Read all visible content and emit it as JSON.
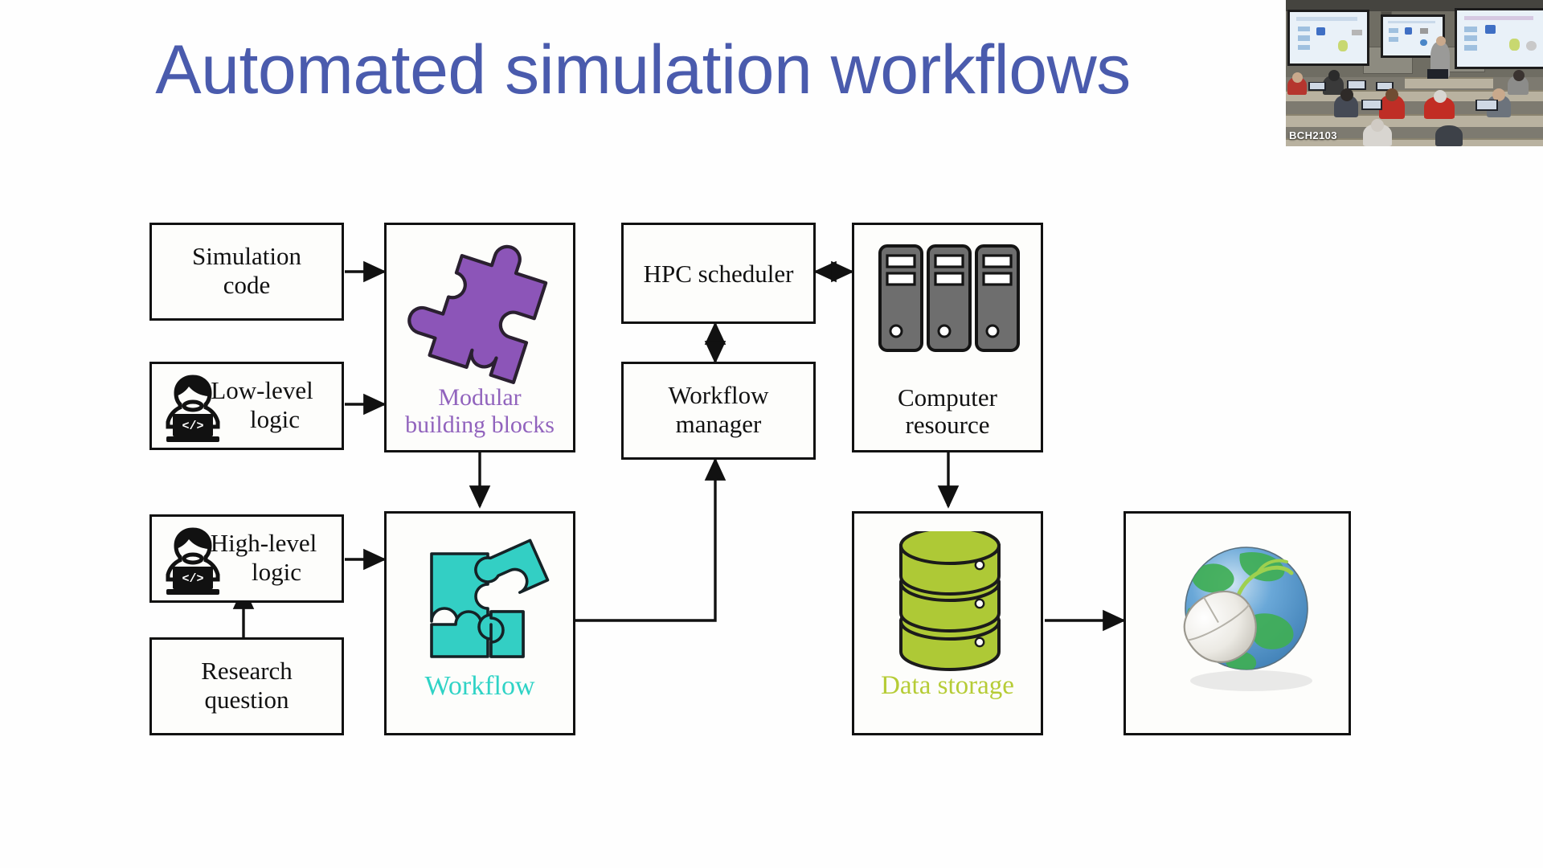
{
  "slide": {
    "title": "Automated simulation workflows",
    "background_color": "#fefefe",
    "title_color": "#4a5bad"
  },
  "webcam": {
    "label": "BCH2103",
    "description": "lecture-hall-video-feed"
  },
  "diagram": {
    "boxes": [
      {
        "id": "simulation-code",
        "label": "Simulation\ncode",
        "label_line1": "Simulation",
        "label_line2": "code"
      },
      {
        "id": "low-level-logic",
        "label": "Low-level\nlogic",
        "label_line1": "Low-level",
        "label_line2": "logic"
      },
      {
        "id": "high-level-logic",
        "label": "High-level\nlogic",
        "label_line1": "High-level",
        "label_line2": "logic"
      },
      {
        "id": "research-question",
        "label": "Research\nquestion",
        "label_line1": "Research",
        "label_line2": "question"
      },
      {
        "id": "hpc-scheduler",
        "label": "HPC scheduler",
        "label_line1": "HPC scheduler",
        "label_line2": ""
      },
      {
        "id": "workflow-manager",
        "label": "Workflow\nmanager",
        "label_line1": "Workflow",
        "label_line2": "manager"
      },
      {
        "id": "computer-resource",
        "label": "Computer\nresource",
        "label_line1": "Computer",
        "label_line2": "resource"
      }
    ],
    "captions": {
      "modular_line1": "Modular",
      "modular_line2": "building blocks",
      "modular_color": "#9163bd",
      "workflow": "Workflow",
      "workflow_color": "#2fd3c6",
      "data_storage": "Data storage",
      "data_storage_color": "#b6cc36"
    },
    "icons": {
      "puzzle_piece": "purple-puzzle-piece-icon",
      "puzzle_set": "teal-puzzle-pieces-icon",
      "servers": "server-rack-icon",
      "database": "database-cylinder-icon",
      "globe_mouse": "globe-with-mouse-icon",
      "person_code_low": "person-at-laptop-code-icon",
      "person_code_high": "person-at-laptop-code-icon"
    },
    "colors": {
      "puzzle_purple": "#8c55b8",
      "puzzle_teal": "#33cfc4",
      "server_gray": "#6e6e6e",
      "database_green": "#aec936",
      "box_border": "#111111"
    },
    "arrow_labels": []
  }
}
